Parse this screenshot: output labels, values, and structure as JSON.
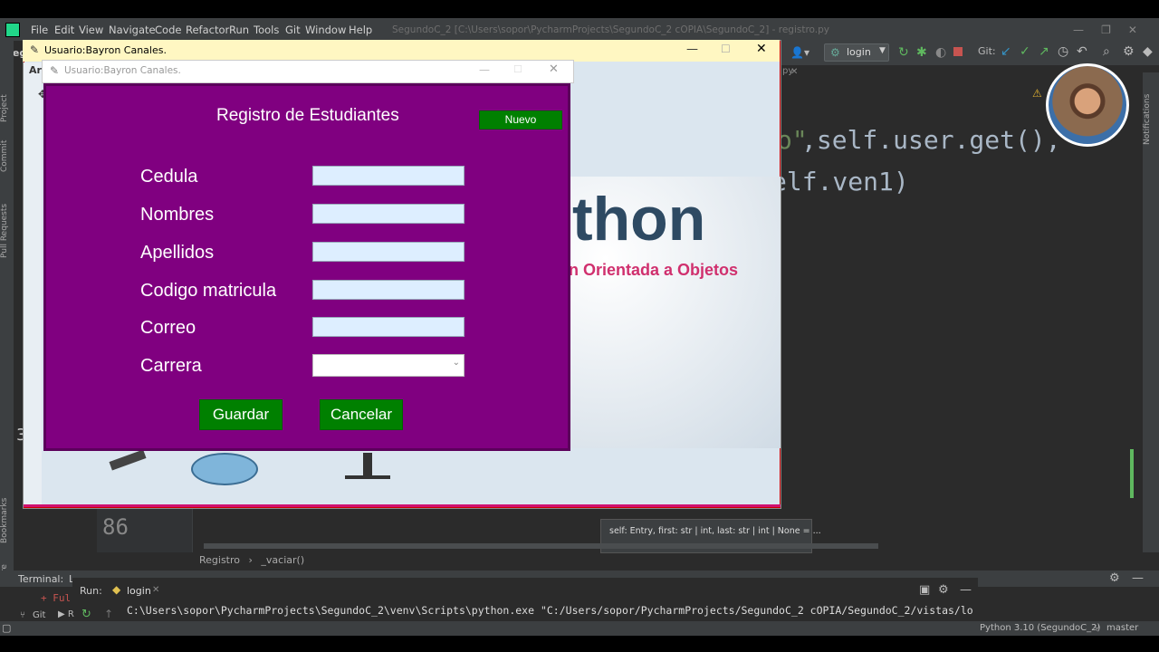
{
  "ide": {
    "title": "SegundoC_2 [C:\\Users\\sopor\\PycharmProjects\\SegundoC_2 cOPIA\\SegundoC_2] - registro.py",
    "project_short": "Segu",
    "menu": [
      "File",
      "Edit",
      "View",
      "Navigate",
      "Code",
      "Refactor",
      "Run",
      "Tools",
      "Git",
      "Window",
      "Help"
    ],
    "run_config": "login",
    "git_label": "Git:",
    "side_labels": [
      "Project",
      "Commit",
      "Pull Requests",
      "Bookmarks",
      "Structure"
    ],
    "notifications_label": "Notifications",
    "code_line1_a": "o\"",
    "code_line1_b": ",self.user.get(),",
    "code_line2": "elf.ven1)",
    "line_number": "86",
    "hint_text": "self: Entry, first: str | int, last: str | int | None = ...",
    "breadcrumb": [
      "Registro",
      "_vaciar()"
    ],
    "tab_fragment": "py",
    "terminal_tab": "Terminal:",
    "terminal_sub": "L",
    "terminal_line": "+ Ful",
    "run_tab": "Run:",
    "run_config_tab": "login",
    "run_command": "C:\\Users\\sopor\\PycharmProjects\\SegundoC_2\\venv\\Scripts\\python.exe \"C:/Users/sopor/PycharmProjects/SegundoC_2 cOPIA/SegundoC_2/vistas/login.p",
    "status_python": "Python 3.10 (SegundoC_2)",
    "status_branch": "master",
    "status_git": "Git",
    "left_num": "3"
  },
  "outer_window": {
    "title": "Usuario:Bayron Canales.",
    "arc_fragment": "Arc",
    "bg_text_big": "thon",
    "bg_text_sub": "n Orientada a Objetos"
  },
  "inner_window": {
    "title": "Usuario:Bayron Canales."
  },
  "form": {
    "title": "Registro de Estudiantes",
    "new_button": "Nuevo",
    "fields": [
      {
        "label": "Cedula",
        "value": ""
      },
      {
        "label": "Nombres",
        "value": ""
      },
      {
        "label": "Apellidos",
        "value": ""
      },
      {
        "label": "Codigo matricula",
        "value": ""
      },
      {
        "label": "Correo",
        "value": ""
      }
    ],
    "carrera_label": "Carrera",
    "carrera_value": "",
    "save_button": "Guardar",
    "cancel_button": "Cancelar"
  },
  "colors": {
    "form_bg": "#800080",
    "button_green": "#008000",
    "input_bg": "#ddeeff",
    "outer_titlebar": "#fff7c2"
  }
}
